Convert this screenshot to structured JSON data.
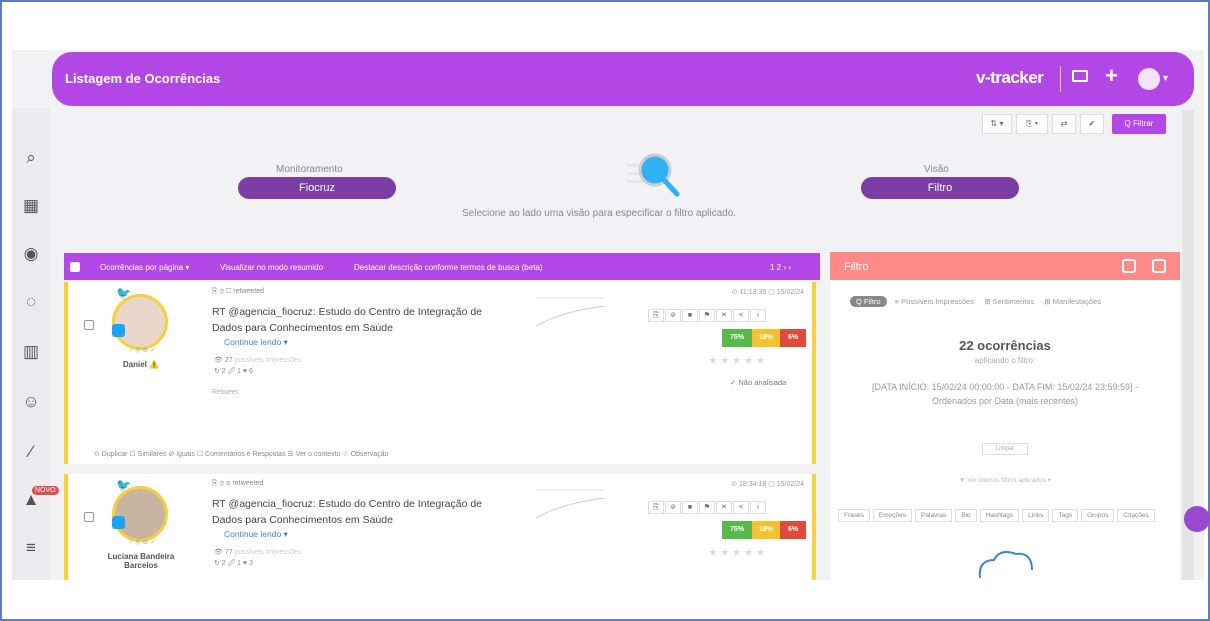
{
  "header": {
    "title": "Listagem de Ocorrências",
    "brand": "v-tracker"
  },
  "toolbar": {
    "filter_button": "Q Filtrar",
    "buttons": [
      "⇅ ▾",
      "⎘ ▾",
      "⇄",
      "✔"
    ]
  },
  "monitor": {
    "label": "Monitoramento",
    "value": "Fiocruz",
    "vision_label": "Visão",
    "vision_value": "Filtro",
    "hint": "Selecione ao lado uma visão para especificar o filtro aplicado."
  },
  "list": {
    "per_page": "Ocorrências por página ▾",
    "summary_mode": "Visualizar no modo resumido",
    "highlight": "Destacar descrição conforme termos de busca (beta)",
    "pages": "1 2 › ›"
  },
  "cards": [
    {
      "name": "Daniel ⚠️",
      "meta": "⎘ ⊘ ☐ retweeted",
      "text": "RT @agencia_fiocruz: Estudo do Centro de Integração de Dados para Conhecimentos em Saúde",
      "more": "Continue lendo ▾",
      "impressions": "👁 27",
      "impressions_label": "possíveis impressões",
      "counts": "↻ 2   🖉 1   ♥ 6",
      "network": "Retweet",
      "date": "⊙ 11:13:35  ▢ 15/02/24",
      "sent": [
        "75%",
        "18%",
        "6%"
      ],
      "status": "✓ Não analisada",
      "footer": "⊙ Duplicar   ☐ Similares   ⊘ Iguais   ☐ Comentários e Respostas   ☰ Ver o contexto   ☆ Observação"
    },
    {
      "name": "Luciana Bandeira Barcelos",
      "meta": "⎘ ⊘ ⊛ retweeted",
      "text": "RT @agencia_fiocruz: Estudo do Centro de Integração de Dados para Conhecimentos em Saúde",
      "more": "Continue lendo ▾",
      "impressions": "👁 77",
      "impressions_label": "possíveis impressões",
      "counts": "↻ 2   🖉 1   ♥ 3",
      "date": "⊙ 18:34:18  ▢ 15/02/24",
      "sent": [
        "75%",
        "18%",
        "6%"
      ]
    }
  ],
  "filter_panel": {
    "title": "Filtro",
    "tabs": [
      "Q Filtro",
      "≡ Possíveis Impressões",
      "⊞ Sentimentos",
      "⊞ Manifestações"
    ],
    "count": "22 ocorrências",
    "sub": "aplicando o filtro:",
    "desc": "[DATA INÍCIO: 15/02/24 00:00:00 - DATA FIM: 15/02/24 23:59:59] - Ordenados por Data (mais recentes)",
    "clear": "Limpar",
    "previous": "▼ Ver últimos filtros aplicados ▾",
    "chips": [
      "Frases",
      "Emoções",
      "Palavras",
      "Bio",
      "Hashtags",
      "Links",
      "Tags",
      "Grupos",
      "Citações"
    ]
  },
  "sidebar_badge": "NOVO"
}
